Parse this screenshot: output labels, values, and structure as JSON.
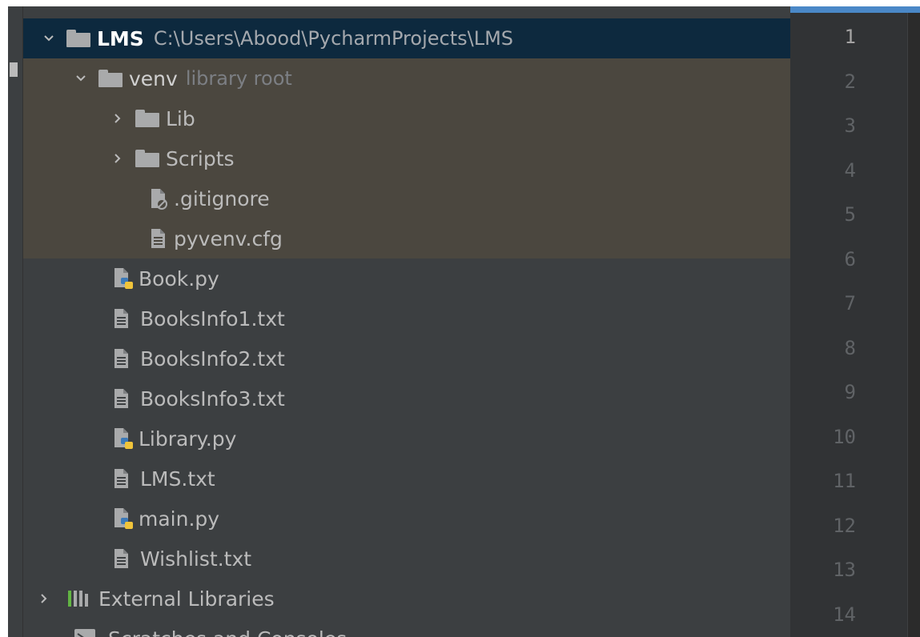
{
  "project_tree": {
    "root": {
      "name": "LMS",
      "path": "C:\\Users\\Abood\\PycharmProjects\\LMS"
    },
    "venv": {
      "name": "venv",
      "tag": "library root"
    },
    "venv_children": [
      {
        "name": "Lib",
        "type": "folder"
      },
      {
        "name": "Scripts",
        "type": "folder"
      },
      {
        "name": ".gitignore",
        "type": "ignore-file"
      },
      {
        "name": "pyvenv.cfg",
        "type": "text-file"
      }
    ],
    "files": [
      {
        "name": "Book.py",
        "type": "python-file"
      },
      {
        "name": "BooksInfo1.txt",
        "type": "text-file"
      },
      {
        "name": "BooksInfo2.txt",
        "type": "text-file"
      },
      {
        "name": "BooksInfo3.txt",
        "type": "text-file"
      },
      {
        "name": "Library.py",
        "type": "python-file"
      },
      {
        "name": "LMS.txt",
        "type": "text-file"
      },
      {
        "name": "main.py",
        "type": "python-file"
      },
      {
        "name": "Wishlist.txt",
        "type": "text-file"
      }
    ],
    "external_libraries": "External Libraries",
    "scratches": "Scratches and Consoles"
  },
  "editor": {
    "line_numbers": [
      "1",
      "2",
      "3",
      "4",
      "5",
      "6",
      "7",
      "8",
      "9",
      "10",
      "11",
      "12",
      "13",
      "14"
    ],
    "current_line": "1"
  },
  "colors": {
    "selected_row": "#0d293e",
    "library_root_bg": "#4b473f",
    "tree_bg": "#3c3f41",
    "accent_bar": "#4a88c7"
  }
}
